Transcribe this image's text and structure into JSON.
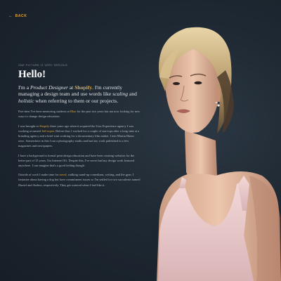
{
  "nav": {
    "back_label": "BACK",
    "back_icon": "arrow-left-icon",
    "accent": "#e0a63a"
  },
  "intro": {
    "eyebrow": "ONE PICTURE IS VERY SERIOUS",
    "title": "Hello!",
    "lead": {
      "t1": "I'm a ",
      "role": "Product Designer",
      "t2": " at ",
      "company": "Shopify",
      "t3": ". I'm currently managing a design team and use words like ",
      "w1": "scaling",
      "t4": " and ",
      "w2": "holistic",
      "t5": " when referring to them or our projects."
    }
  },
  "paragraphs": {
    "p1": {
      "a": "Part-time I've been mentoring students at ",
      "link": "Blue",
      "b": " for the past two years but am now looking for new ways to change design education."
    },
    "p2": {
      "a": "I was brought to ",
      "link1": "Shopify",
      "b": " three years ago when it acquired the User Experience agency I was working at named ",
      "link2": "JetCooper",
      "c": ". Before that, I worked for a couple of start-ups after a long stint at a branding agency and a brief stint working for a documentary film maker. I met Martin Hanes once. Somewhere in this I ran a photography studio and had my work published in a few magazines and newspapers."
    },
    "p3": {
      "text": "I have a background in formal print design education and have been creating websites for the better part of 15 years. I'm Internet OG. Despite this, I've never had my design work featured anywhere. I can imagine that's a good feeling though."
    },
    "p4": {
      "a": "Outside of work I make time for ",
      "link": "travel",
      "b": ", stalking stand-up comedians, writing, and the gym. I fantasize about having a dog but have commitment issues so I'm settled for two succulents named ",
      "n1": "Daniel",
      "c": " and ",
      "n2": "Andrea",
      "d": ", respectively. They get watered when I feel like it."
    }
  },
  "portrait": {
    "alt": "Portrait of a woman with short blonde hair in a pink tank top"
  }
}
